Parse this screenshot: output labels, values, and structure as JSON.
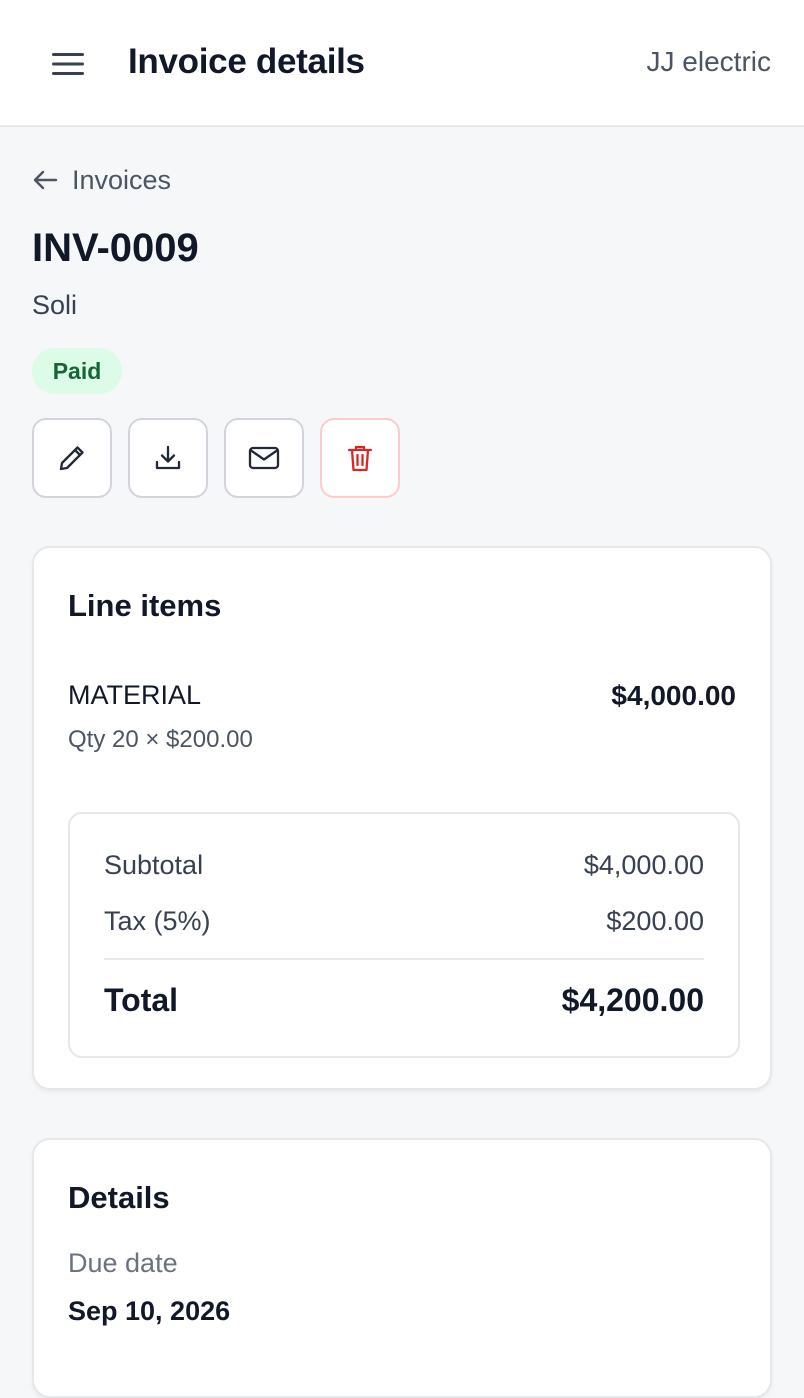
{
  "header": {
    "title": "Invoice details",
    "company": "JJ electric"
  },
  "breadcrumb": {
    "back_label": "Invoices"
  },
  "invoice": {
    "number": "INV-0009",
    "client": "Soli",
    "status": "Paid"
  },
  "actions": {
    "edit_icon": "pencil-icon",
    "download_icon": "download-icon",
    "email_icon": "mail-icon",
    "delete_icon": "trash-icon"
  },
  "line_items": {
    "title": "Line items",
    "items": [
      {
        "name": "MATERIAL",
        "qty_line": "Qty 20 × $200.00",
        "amount": "$4,000.00"
      }
    ]
  },
  "summary": {
    "subtotal_label": "Subtotal",
    "subtotal_value": "$4,000.00",
    "tax_label": "Tax (5%)",
    "tax_value": "$200.00",
    "total_label": "Total",
    "total_value": "$4,200.00"
  },
  "details": {
    "title": "Details",
    "due_date_label": "Due date",
    "due_date_value": "Sep 10, 2026"
  },
  "colors": {
    "paid_bg": "#dcfce7",
    "paid_text": "#166534",
    "danger": "#dc2626"
  }
}
